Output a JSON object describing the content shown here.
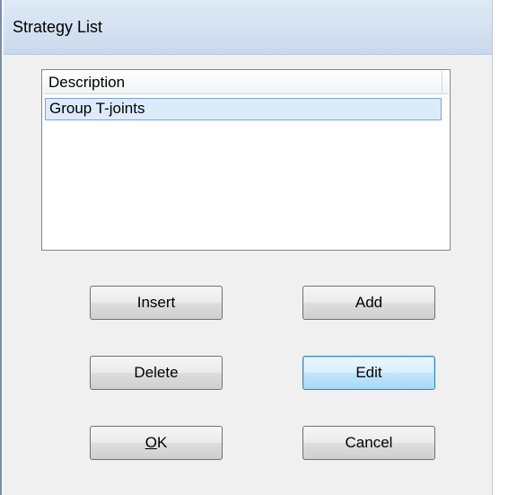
{
  "window": {
    "title": "Strategy List"
  },
  "list": {
    "columns": [
      "Description"
    ],
    "rows": [
      {
        "description": "Group T-joints",
        "selected": true
      }
    ]
  },
  "buttons": {
    "insert": "Insert",
    "add": "Add",
    "delete": "Delete",
    "edit": "Edit",
    "ok_mnemonic": "O",
    "ok_rest": "K",
    "cancel": "Cancel"
  },
  "colors": {
    "selection_fill": "#dcebfc",
    "selection_border": "#7da2ce",
    "dialog_face": "#f0f0f0",
    "titlebar": "#c9d9ec"
  }
}
